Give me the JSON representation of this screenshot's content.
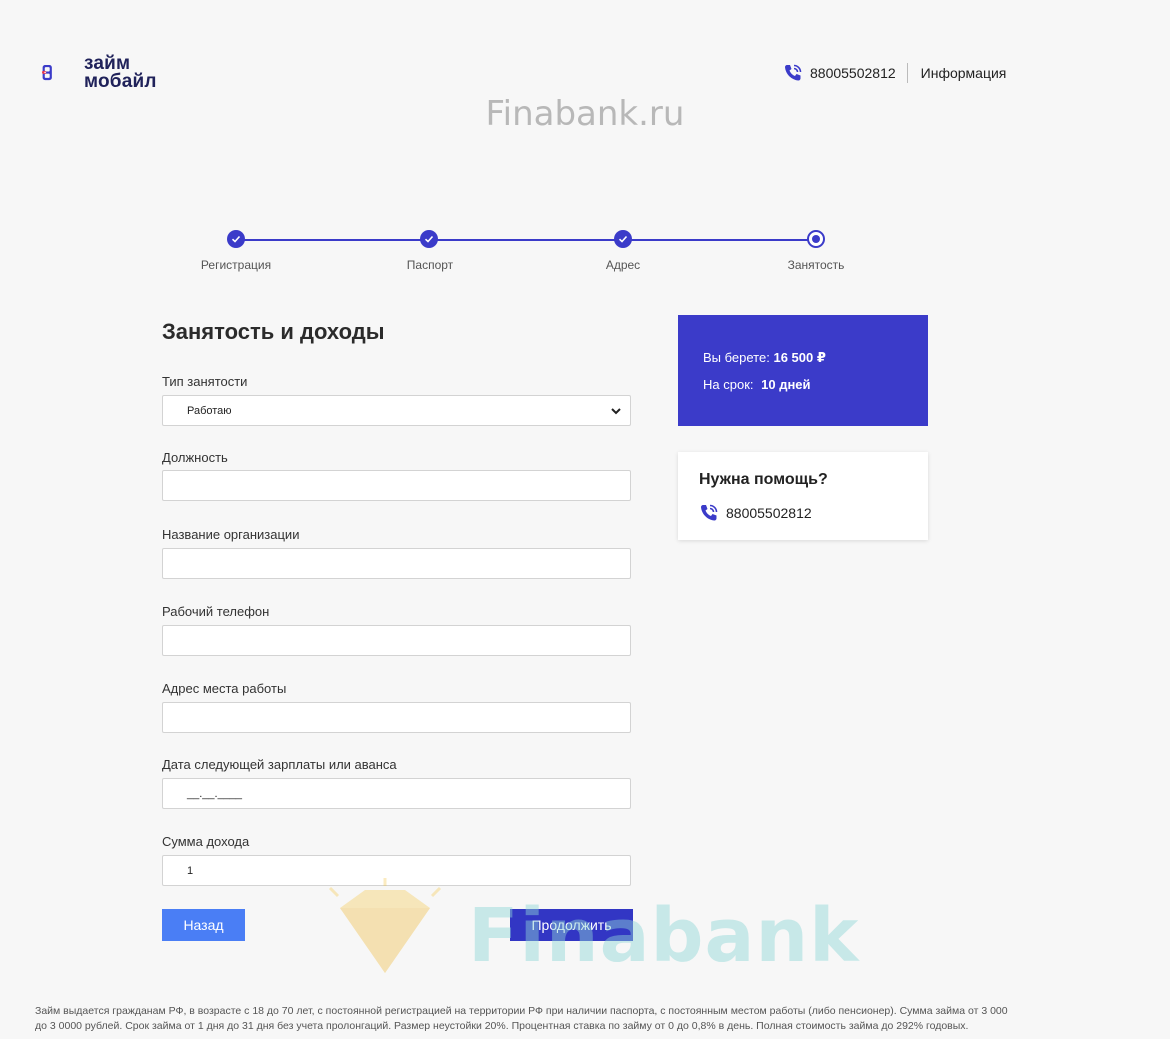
{
  "header": {
    "logo_line1": "займ",
    "logo_line2": "мобайл",
    "phone": "88005502812",
    "info_link": "Информация",
    "watermark": "Finabank.ru"
  },
  "stepper": {
    "steps": [
      {
        "label": "Регистрация",
        "state": "done"
      },
      {
        "label": "Паспорт",
        "state": "done"
      },
      {
        "label": "Адрес",
        "state": "done"
      },
      {
        "label": "Занятость",
        "state": "current"
      }
    ]
  },
  "form": {
    "title": "Занятость и доходы",
    "employment_type": {
      "label": "Тип занятости",
      "value": "Работаю"
    },
    "position": {
      "label": "Должность",
      "value": ""
    },
    "organization": {
      "label": "Название организации",
      "value": ""
    },
    "work_phone": {
      "label": "Рабочий телефон",
      "value": ""
    },
    "work_address": {
      "label": "Адрес места работы",
      "value": ""
    },
    "next_salary_date": {
      "label": "Дата следующей зарплаты или аванса",
      "value": "__.__.____"
    },
    "income": {
      "label": "Сумма дохода",
      "value": "1"
    },
    "back_button": "Назад",
    "continue_button": "Продолжить"
  },
  "loan_summary": {
    "amount_label": "Вы берете:",
    "amount_value": "16 500 ₽",
    "term_label": "На срок:",
    "term_value": "10 дней"
  },
  "help": {
    "title": "Нужна помощь?",
    "phone": "88005502812"
  },
  "watermark_bottom": "Finabank",
  "footer": {
    "disclaimer": "Займ выдается гражданам РФ, в возрасте с 18 до 70 лет, с постоянной регистрацией на территории РФ при наличии паспорта, с постоянным местом работы (либо пенсионер). Сумма займа от 3 000 до 3 0000 рублей. Срок займа от 1 дня до 31 дня без учета пролонгаций. Размер неустойки 20%. Процентная ставка по займу от 0 до 0,8% в день. Полная стоимость займа до 292% годовых."
  },
  "colors": {
    "accent": "#3b3bc9",
    "back_button": "#4a7ef5",
    "logo_red": "#e8384f"
  }
}
